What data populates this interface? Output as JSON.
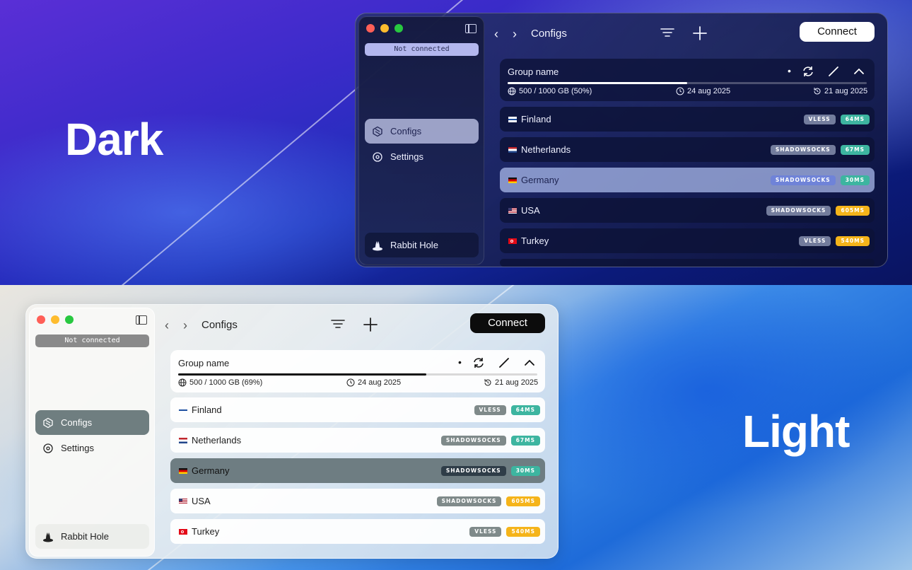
{
  "modes": {
    "dark_title": "Dark",
    "light_title": "Light"
  },
  "window": {
    "status": "Not connected",
    "nav": {
      "configs": "Configs",
      "settings": "Settings",
      "profile": "Rabbit Hole"
    },
    "toolbar": {
      "title": "Configs",
      "connect_label": "Connect"
    }
  },
  "group": {
    "name": "Group name",
    "dot": "•",
    "dark": {
      "usage": "500 / 1000 GB (50%)",
      "usage_fraction": 0.5
    },
    "light": {
      "usage": "500 / 1000 GB (69%)",
      "usage_fraction": 0.69
    },
    "expires": "24 aug 2025",
    "updated": "21 aug 2025"
  },
  "configs": [
    {
      "country": "Finland",
      "flag": "finland-flag-icon",
      "protocol": "VLESS",
      "ping": "64MS",
      "status": "ok"
    },
    {
      "country": "Netherlands",
      "flag": "netherlands-flag-icon",
      "protocol": "SHADOWSOCKS",
      "ping": "67MS",
      "status": "ok"
    },
    {
      "country": "Germany",
      "flag": "germany-flag-icon",
      "protocol": "SHADOWSOCKS",
      "ping": "30MS",
      "status": "ok",
      "selected": true
    },
    {
      "country": "USA",
      "flag": "usa-flag-icon",
      "protocol": "SHADOWSOCKS",
      "ping": "605MS",
      "status": "warn"
    },
    {
      "country": "Turkey",
      "flag": "turkey-flag-icon",
      "protocol": "VLESS",
      "ping": "540MS",
      "status": "warn"
    }
  ],
  "colors": {
    "ping_ok": "#3db5a0",
    "ping_warn": "#f5b41a",
    "traffic_red": "#ff5f57",
    "traffic_yellow": "#febc2e",
    "traffic_green": "#28c840"
  }
}
